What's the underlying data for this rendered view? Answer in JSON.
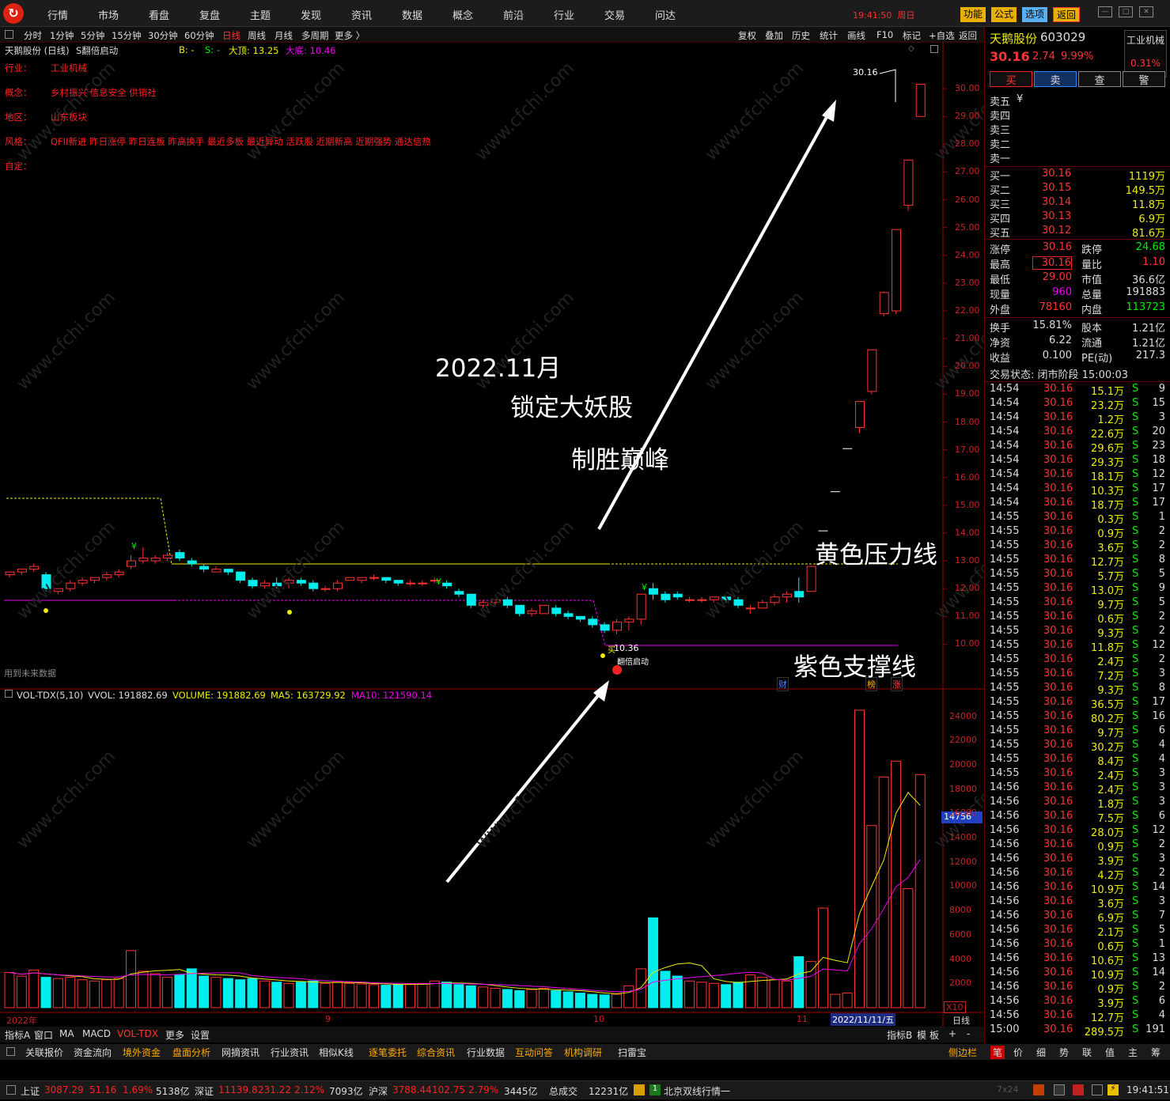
{
  "topbar": {
    "menus": [
      "行情",
      "市场",
      "看盘",
      "复盘",
      "主题",
      "发现",
      "资讯",
      "数据",
      "概念",
      "前沿",
      "行业",
      "交易",
      "问达"
    ],
    "time": "19:41:50",
    "weekday": "周日",
    "buttons": [
      "功能",
      "公式",
      "选项",
      "返回"
    ]
  },
  "toolbar": {
    "periods": [
      "分时",
      "1分钟",
      "5分钟",
      "15分钟",
      "30分钟",
      "60分钟",
      "日线",
      "周线",
      "月线",
      "多周期",
      "更多 〉"
    ],
    "tools": [
      "复权",
      "叠加",
      "历史",
      "统计",
      "画线",
      "F10",
      "标记",
      "+自选",
      "返回"
    ]
  },
  "chart_header": {
    "name": "天鹅股份 (日线)",
    "indicator": "S翻倍启动",
    "b": "B: -",
    "s": "S: -",
    "top": "大顶: 13.25",
    "bottom": "大底: 10.46"
  },
  "info": {
    "labels": [
      "行业：",
      "概念：",
      "地区：",
      "风格：",
      "自定："
    ],
    "values": [
      "工业机械",
      "乡村振兴 信息安全 供销社",
      "山东板块",
      "QFII新进 昨日涨停 昨日连板 昨高换手 最近多板 最近异动 活跃股 近期新高 近期强势 通达信热",
      ""
    ]
  },
  "yaxis": [
    "30.00",
    "29.00",
    "28.00",
    "27.00",
    "26.00",
    "25.00",
    "24.00",
    "23.00",
    "22.00",
    "21.00",
    "20.00",
    "19.00",
    "18.00",
    "17.00",
    "16.00",
    "15.00",
    "14.00",
    "13.00",
    "12.00",
    "11.00",
    "10.00"
  ],
  "vol_axis": [
    "24000",
    "22000",
    "20000",
    "18000",
    "16000",
    "14000",
    "12000",
    "10000",
    "8000",
    "6000",
    "4000",
    "2000"
  ],
  "vol_header": {
    "name": "VOL-TDX(5,10)",
    "vvol": "VVOL: 191882.69",
    "volume": "VOLUME: 191882.69",
    "ma5": "MA5: 163729.92",
    "ma10": "MA10: 121590.14"
  },
  "vol_marker": "14756",
  "future_note": "用到未来数据",
  "chart_labels": {
    "high": "30.16",
    "low_val": "10.36",
    "signal": "翻倍启动",
    "buy": "买",
    "cai": "财",
    "bang": "榜",
    "zhang": "涨",
    "x10": "X10",
    "date_current": "2022/11/11/五"
  },
  "xaxis": {
    "labels": [
      "2022年",
      "9",
      "10",
      "11"
    ],
    "period": "日线"
  },
  "annotations": {
    "date": "2022.11月",
    "line1": "锁定大妖股",
    "line2": "制胜巅峰",
    "yellow": "黄色压力线",
    "purple": "紫色支撑线"
  },
  "bottom_tabs": [
    "指标A",
    "窗口",
    "MA",
    "MACD",
    "VOL-TDX",
    "更多",
    "设置"
  ],
  "bottom_right": [
    "指标B",
    "模",
    "板",
    "+",
    "-"
  ],
  "bottom_nav": [
    "关联报价",
    "资金流向",
    "境外资金",
    "盘面分析",
    "网摘资讯",
    "行业资讯",
    "相似K线",
    "逐笔委托",
    "综合资讯",
    "行业数据",
    "互动问答",
    "机构调研",
    "扫雷宝"
  ],
  "side_label": "侧边栏",
  "right_tabs": [
    "笔",
    "价",
    "细",
    "势",
    "联",
    "值",
    "主",
    "筹"
  ],
  "quote": {
    "name": "天鹅股份",
    "code": "603029",
    "price": "30.16",
    "change": "2.74",
    "pct": "9.99%",
    "industry": "工业机械",
    "ind_pct": "0.31%",
    "actions": [
      "买",
      "卖",
      "查",
      "警"
    ],
    "sell": [
      [
        "卖五",
        ""
      ],
      [
        "卖四",
        ""
      ],
      [
        "卖三",
        ""
      ],
      [
        "卖二",
        ""
      ],
      [
        "卖一",
        ""
      ]
    ],
    "sell5_mark": "¥",
    "buy": [
      [
        "买一",
        "30.16",
        "1119万"
      ],
      [
        "买二",
        "30.15",
        "149.5万"
      ],
      [
        "买三",
        "30.14",
        "11.8万"
      ],
      [
        "买四",
        "30.13",
        "6.9万"
      ],
      [
        "买五",
        "30.12",
        "81.6万"
      ]
    ],
    "stats": [
      [
        "涨停",
        "30.16",
        "跌停",
        "24.68"
      ],
      [
        "最高",
        "30.16",
        "量比",
        "1.10"
      ],
      [
        "最低",
        "29.00",
        "市值",
        "36.6亿"
      ],
      [
        "现量",
        "960",
        "总量",
        "191883"
      ],
      [
        "外盘",
        "78160",
        "内盘",
        "113723"
      ],
      [
        "换手",
        "15.81%",
        "股本",
        "1.21亿"
      ],
      [
        "净资",
        "6.22",
        "流通",
        "1.21亿"
      ],
      [
        "收益",
        "0.100",
        "PE(动)",
        "217.3"
      ]
    ],
    "trade_state": "交易状态: 闭市阶段 15:00:03"
  },
  "ticks": [
    [
      "14:54",
      "30.16",
      "15.1万",
      "S",
      "9"
    ],
    [
      "14:54",
      "30.16",
      "23.2万",
      "S",
      "15"
    ],
    [
      "14:54",
      "30.16",
      "1.2万",
      "S",
      "3"
    ],
    [
      "14:54",
      "30.16",
      "22.6万",
      "S",
      "20"
    ],
    [
      "14:54",
      "30.16",
      "29.6万",
      "S",
      "23"
    ],
    [
      "14:54",
      "30.16",
      "29.3万",
      "S",
      "18"
    ],
    [
      "14:54",
      "30.16",
      "18.1万",
      "S",
      "12"
    ],
    [
      "14:54",
      "30.16",
      "10.3万",
      "S",
      "17"
    ],
    [
      "14:54",
      "30.16",
      "18.7万",
      "S",
      "17"
    ],
    [
      "14:55",
      "30.16",
      "0.3万",
      "S",
      "1"
    ],
    [
      "14:55",
      "30.16",
      "0.9万",
      "S",
      "2"
    ],
    [
      "14:55",
      "30.16",
      "3.6万",
      "S",
      "2"
    ],
    [
      "14:55",
      "30.16",
      "12.7万",
      "S",
      "8"
    ],
    [
      "14:55",
      "30.16",
      "5.7万",
      "S",
      "5"
    ],
    [
      "14:55",
      "30.16",
      "13.0万",
      "S",
      "9"
    ],
    [
      "14:55",
      "30.16",
      "9.7万",
      "S",
      "5"
    ],
    [
      "14:55",
      "30.16",
      "0.6万",
      "S",
      "2"
    ],
    [
      "14:55",
      "30.16",
      "9.3万",
      "S",
      "2"
    ],
    [
      "14:55",
      "30.16",
      "11.8万",
      "S",
      "12"
    ],
    [
      "14:55",
      "30.16",
      "2.4万",
      "S",
      "2"
    ],
    [
      "14:55",
      "30.16",
      "7.2万",
      "S",
      "3"
    ],
    [
      "14:55",
      "30.16",
      "9.3万",
      "S",
      "8"
    ],
    [
      "14:55",
      "30.16",
      "36.5万",
      "S",
      "17"
    ],
    [
      "14:55",
      "30.16",
      "80.2万",
      "S",
      "16"
    ],
    [
      "14:55",
      "30.16",
      "9.7万",
      "S",
      "6"
    ],
    [
      "14:55",
      "30.16",
      "30.2万",
      "S",
      "4"
    ],
    [
      "14:55",
      "30.16",
      "8.4万",
      "S",
      "4"
    ],
    [
      "14:55",
      "30.16",
      "2.4万",
      "S",
      "3"
    ],
    [
      "14:56",
      "30.16",
      "2.4万",
      "S",
      "3"
    ],
    [
      "14:56",
      "30.16",
      "1.8万",
      "S",
      "3"
    ],
    [
      "14:56",
      "30.16",
      "7.5万",
      "S",
      "6"
    ],
    [
      "14:56",
      "30.16",
      "28.0万",
      "S",
      "12"
    ],
    [
      "14:56",
      "30.16",
      "0.9万",
      "S",
      "2"
    ],
    [
      "14:56",
      "30.16",
      "3.9万",
      "S",
      "3"
    ],
    [
      "14:56",
      "30.16",
      "4.2万",
      "S",
      "2"
    ],
    [
      "14:56",
      "30.16",
      "10.9万",
      "S",
      "14"
    ],
    [
      "14:56",
      "30.16",
      "3.6万",
      "S",
      "3"
    ],
    [
      "14:56",
      "30.16",
      "6.9万",
      "S",
      "7"
    ],
    [
      "14:56",
      "30.16",
      "2.1万",
      "S",
      "5"
    ],
    [
      "14:56",
      "30.16",
      "0.6万",
      "S",
      "1"
    ],
    [
      "14:56",
      "30.16",
      "10.6万",
      "S",
      "13"
    ],
    [
      "14:56",
      "30.16",
      "10.9万",
      "S",
      "14"
    ],
    [
      "14:56",
      "30.16",
      "0.9万",
      "S",
      "2"
    ],
    [
      "14:56",
      "30.16",
      "3.9万",
      "S",
      "6"
    ],
    [
      "14:56",
      "30.16",
      "12.7万",
      "S",
      "4"
    ],
    [
      "15:00",
      "30.16",
      "289.5万",
      "S",
      "191"
    ]
  ],
  "status": {
    "sh_name": "上证",
    "sh": "3087.29",
    "sh_chg": "51.16",
    "sh_pct": "1.69%",
    "sh_amt": "5138亿",
    "sz_name": "深证",
    "sz": "11139.8",
    "sz_chg": "231.22",
    "sz_pct": "2.12%",
    "sz_amt": "7093亿",
    "hs_name": "沪深",
    "hs": "3788.44",
    "hs_chg": "102.75",
    "hs_pct": "2.79%",
    "hs_amt": "3445亿",
    "total_label": "总成交",
    "total": "12231亿",
    "feed": "北京双线行情一",
    "time": "19:41:51",
    "hours": "7x24"
  },
  "chart_data": {
    "type": "candlestick",
    "title": "天鹅股份 (日线)",
    "ylim": [
      9.5,
      30.8
    ],
    "candles": [
      [
        12.5,
        12.6,
        12.4,
        12.6
      ],
      [
        12.6,
        12.7,
        12.5,
        12.7
      ],
      [
        12.7,
        12.9,
        12.6,
        12.8
      ],
      [
        12.5,
        12.6,
        11.9,
        12.0
      ],
      [
        11.9,
        12.0,
        11.8,
        12.0
      ],
      [
        12.0,
        12.3,
        11.9,
        12.2
      ],
      [
        12.2,
        12.4,
        12.1,
        12.3
      ],
      [
        12.3,
        12.4,
        12.2,
        12.4
      ],
      [
        12.4,
        12.6,
        12.3,
        12.5
      ],
      [
        12.5,
        12.7,
        12.4,
        12.6
      ],
      [
        12.8,
        13.2,
        12.7,
        13.0
      ],
      [
        13.0,
        13.5,
        12.9,
        13.1
      ],
      [
        13.0,
        13.2,
        12.9,
        13.1
      ],
      [
        13.1,
        13.3,
        13.0,
        13.2
      ],
      [
        13.3,
        13.4,
        13.0,
        13.1
      ],
      [
        13.0,
        13.1,
        12.8,
        12.9
      ],
      [
        12.8,
        12.9,
        12.6,
        12.7
      ],
      [
        12.6,
        12.8,
        12.6,
        12.7
      ],
      [
        12.7,
        12.7,
        12.5,
        12.6
      ],
      [
        12.6,
        12.6,
        12.2,
        12.3
      ],
      [
        12.3,
        12.4,
        12.0,
        12.1
      ],
      [
        12.1,
        12.3,
        12.0,
        12.2
      ],
      [
        12.2,
        12.4,
        12.0,
        12.1
      ],
      [
        12.2,
        12.4,
        12.0,
        12.3
      ],
      [
        12.3,
        12.4,
        12.1,
        12.2
      ],
      [
        12.2,
        12.3,
        11.9,
        12.0
      ],
      [
        12.0,
        12.1,
        11.9,
        12.0
      ],
      [
        12.0,
        12.3,
        11.9,
        12.2
      ],
      [
        12.3,
        12.4,
        12.3,
        12.4
      ],
      [
        12.3,
        12.4,
        12.2,
        12.4
      ],
      [
        12.4,
        12.5,
        12.3,
        12.4
      ],
      [
        12.4,
        12.4,
        12.2,
        12.3
      ],
      [
        12.3,
        12.3,
        12.1,
        12.2
      ],
      [
        12.2,
        12.3,
        12.1,
        12.2
      ],
      [
        12.2,
        12.3,
        12.1,
        12.2
      ],
      [
        12.3,
        12.4,
        12.2,
        12.3
      ],
      [
        12.2,
        12.3,
        12.0,
        12.1
      ],
      [
        11.9,
        12.0,
        11.7,
        11.8
      ],
      [
        11.8,
        11.8,
        11.3,
        11.4
      ],
      [
        11.4,
        11.6,
        11.3,
        11.5
      ],
      [
        11.5,
        11.6,
        11.4,
        11.6
      ],
      [
        11.6,
        11.7,
        11.3,
        11.4
      ],
      [
        11.4,
        11.4,
        11.0,
        11.1
      ],
      [
        11.1,
        11.3,
        11.0,
        11.2
      ],
      [
        11.1,
        11.4,
        11.1,
        11.4
      ],
      [
        11.3,
        11.4,
        11.0,
        11.1
      ],
      [
        11.1,
        11.2,
        10.9,
        11.0
      ],
      [
        11.0,
        11.0,
        10.8,
        10.9
      ],
      [
        10.9,
        11.0,
        10.6,
        10.7
      ],
      [
        10.7,
        10.8,
        10.4,
        10.5
      ],
      [
        10.5,
        10.9,
        10.36,
        10.8
      ],
      [
        10.8,
        11.0,
        10.5,
        10.9
      ],
      [
        10.9,
        11.8,
        10.7,
        11.8
      ],
      [
        12.0,
        12.2,
        11.6,
        11.8
      ],
      [
        11.8,
        11.9,
        11.5,
        11.6
      ],
      [
        11.8,
        11.9,
        11.6,
        11.7
      ],
      [
        11.6,
        11.7,
        11.5,
        11.6
      ],
      [
        11.6,
        11.7,
        11.5,
        11.6
      ],
      [
        11.6,
        11.7,
        11.5,
        11.7
      ],
      [
        11.7,
        11.7,
        11.5,
        11.6
      ],
      [
        11.6,
        11.7,
        11.3,
        11.4
      ],
      [
        11.3,
        11.4,
        11.1,
        11.3
      ],
      [
        11.3,
        11.6,
        11.3,
        11.5
      ],
      [
        11.5,
        11.8,
        11.4,
        11.7
      ],
      [
        11.7,
        11.9,
        11.5,
        11.8
      ],
      [
        11.9,
        12.4,
        11.5,
        11.7
      ],
      [
        11.9,
        12.8,
        11.9,
        12.8
      ],
      [
        14.08,
        14.08,
        14.08,
        14.08
      ],
      [
        15.49,
        15.49,
        15.49,
        15.49
      ],
      [
        17.04,
        17.04,
        17.04,
        17.04
      ],
      [
        17.8,
        18.7,
        17.6,
        18.74
      ],
      [
        19.1,
        20.6,
        19.0,
        20.6
      ],
      [
        21.9,
        22.7,
        21.8,
        22.66
      ],
      [
        22.0,
        24.95,
        21.9,
        24.93
      ],
      [
        25.8,
        27.43,
        25.6,
        27.43
      ],
      [
        29.0,
        30.16,
        29.0,
        30.16
      ]
    ],
    "volumes": [
      2900,
      2600,
      3100,
      2500,
      2400,
      2500,
      2300,
      2200,
      2300,
      2400,
      4700,
      3000,
      2800,
      2500,
      2700,
      3200,
      2600,
      2500,
      2400,
      2300,
      2400,
      2200,
      2100,
      2000,
      2100,
      2200,
      2000,
      2100,
      2000,
      1950,
      1900,
      1850,
      1900,
      1950,
      2000,
      2200,
      2100,
      1900,
      1800,
      1700,
      1600,
      1500,
      1400,
      1500,
      1600,
      1400,
      1300,
      1200,
      1100,
      1050,
      1100,
      1800,
      3200,
      7400,
      3000,
      2600,
      2200,
      2100,
      2000,
      1900,
      2100,
      2700,
      2500,
      2300,
      2200,
      4200,
      3800,
      8200,
      1100,
      1200,
      24500,
      15000,
      19000,
      20300,
      9800,
      19200
    ]
  }
}
